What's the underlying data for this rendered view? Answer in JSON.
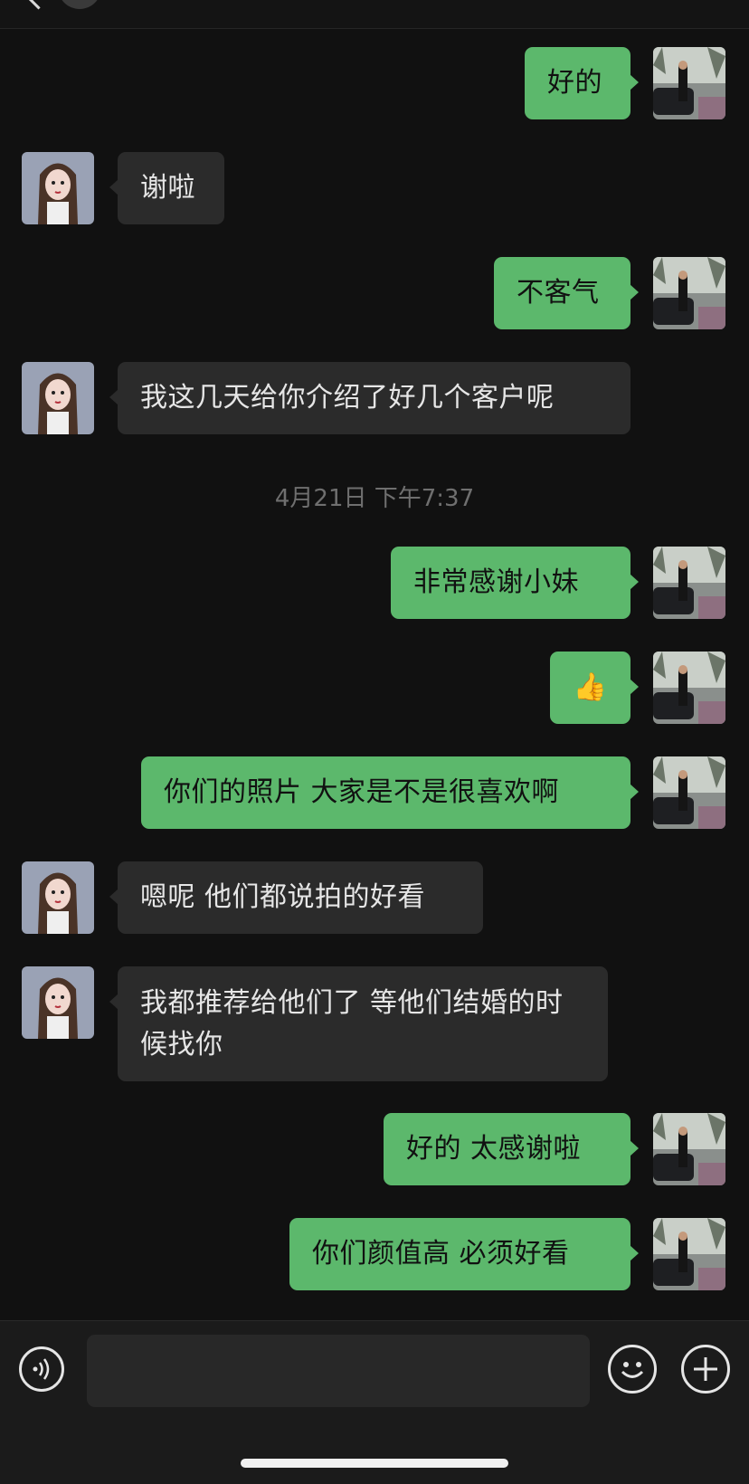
{
  "timestamp": "4月21日 下午7:37",
  "messages": [
    {
      "side": "me",
      "text": "好的"
    },
    {
      "side": "other",
      "text": "谢啦"
    },
    {
      "side": "me",
      "text": "不客气"
    },
    {
      "side": "other",
      "text": "我这几天给你介绍了好几个客户呢"
    },
    {
      "side": "me",
      "text": "非常感谢小妹"
    },
    {
      "side": "me",
      "text": "👍"
    },
    {
      "side": "me",
      "text": "你们的照片 大家是不是很喜欢啊"
    },
    {
      "side": "other",
      "text": "嗯呢 他们都说拍的好看"
    },
    {
      "side": "other",
      "text": "我都推荐给他们了 等他们结婚的时候找你"
    },
    {
      "side": "me",
      "text": "好的 太感谢啦"
    },
    {
      "side": "me",
      "text": "你们颜值高 必须好看"
    }
  ],
  "colors": {
    "my_bubble": "#5cb86c",
    "other_bubble": "#2b2b2b",
    "background": "#111111"
  }
}
